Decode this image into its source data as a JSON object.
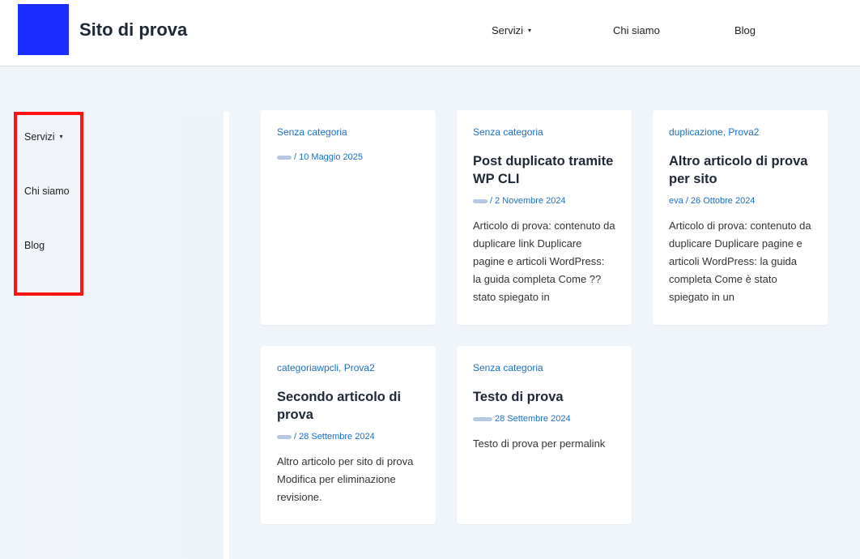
{
  "site": {
    "title": "Sito di prova",
    "logo_color": "#1a2eff"
  },
  "nav": {
    "items": [
      {
        "label": "Servizi",
        "has_dropdown": true
      },
      {
        "label": "Chi siamo"
      },
      {
        "label": "Blog"
      }
    ],
    "caret": "▾"
  },
  "sidebar": {
    "items": [
      {
        "label": "Servizi",
        "has_dropdown": true
      },
      {
        "label": "Chi siamo"
      },
      {
        "label": "Blog"
      }
    ],
    "highlight_color": "#ff1212"
  },
  "posts": [
    {
      "categories": [
        "Senza categoria"
      ],
      "title": "",
      "author": "",
      "date_text": "/ 10 Maggio 2025",
      "excerpt": ""
    },
    {
      "categories": [
        "Senza categoria"
      ],
      "title": "Post duplicato tramite WP CLI",
      "author": "",
      "date_text": "/ 2 Novembre 2024",
      "excerpt": "Articolo di prova: contenuto da duplicare link Duplicare pagine e articoli WordPress: la guida completa Come ?? stato spiegato in"
    },
    {
      "categories": [
        "duplicazione,",
        "Prova2"
      ],
      "title": "Altro articolo di prova per sito",
      "author": "eva",
      "date_text": "/ 26 Ottobre 2024",
      "excerpt": "Articolo di prova: contenuto da duplicare Duplicare pagine e articoli WordPress: la guida completa Come è stato spiegato in un"
    },
    {
      "categories": [
        "categoriawpcli,",
        "Prova2"
      ],
      "title": "Secondo articolo di prova",
      "author": "",
      "date_text": "/ 28 Settembre 2024",
      "excerpt": "Altro articolo per sito di prova Modifica per eliminazione revisione."
    },
    {
      "categories": [
        "Senza categoria"
      ],
      "title": "Testo di prova",
      "author": "",
      "date_text": "28 Settembre 2024",
      "excerpt": "Testo di prova per permalink"
    }
  ],
  "colors": {
    "link": "#1b6fc6",
    "background": "#f0f5fa",
    "title": "#1e2836"
  }
}
